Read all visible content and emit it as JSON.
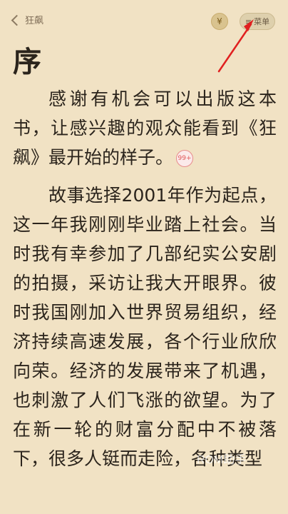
{
  "header": {
    "back_label": "狂飙",
    "coin_icon": "¥",
    "menu_icon": "≡",
    "menu_label": "菜单"
  },
  "chapter": {
    "title": "序"
  },
  "paragraphs": {
    "p1": "感谢有机会可以出版这本书，让感兴趣的观众能看到《狂飙》最开始的样子。",
    "p1_badge": "99+",
    "p2": "故事选择2001年作为起点，这一年我刚刚毕业踏上社会。当时我有幸参加了几部纪实公安剧的拍摄，采访让我大开眼界。彼时我国刚加入世界贸易组织，经济持续高速发展，各个行业欣欣向荣。经济的发展带来了机遇，也刺激了人们飞涨的欲望。为了在新一轮的财富分配中不被落下，很多人铤而走险，各种类型"
  },
  "watermark": "ROM助手",
  "colors": {
    "background": "#f1e2c4",
    "text": "#2b241c",
    "annotation_arrow": "#e02020",
    "badge": "#e05656"
  }
}
